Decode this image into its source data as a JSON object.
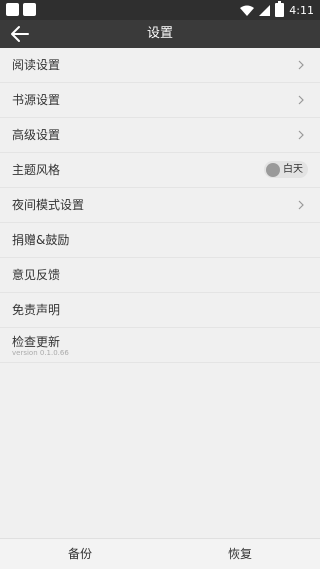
{
  "status_bar": {
    "time": "4:11",
    "battery_level": "",
    "icons": [
      "notification-square-icon",
      "notification-square-icon",
      "wifi-icon",
      "signal-icon",
      "battery-icon"
    ]
  },
  "appbar": {
    "title": "设置",
    "back_icon": "arrow-left-icon"
  },
  "settings": {
    "items": [
      {
        "label": "阅读设置",
        "type": "link"
      },
      {
        "label": "书源设置",
        "type": "link"
      },
      {
        "label": "高级设置",
        "type": "link"
      },
      {
        "label": "主题风格",
        "type": "toggle",
        "toggle_text": "白天"
      },
      {
        "label": "夜间模式设置",
        "type": "link"
      },
      {
        "label": "捐赠&鼓励",
        "type": "plain"
      },
      {
        "label": "意见反馈",
        "type": "plain"
      },
      {
        "label": "免责声明",
        "type": "plain"
      },
      {
        "label": "检查更新",
        "type": "plain",
        "subtitle": "version 0.1.0.66"
      }
    ]
  },
  "bottom_bar": {
    "backup_label": "备份",
    "restore_label": "恢复"
  },
  "colors": {
    "statusbar_bg": "#2f2f2f",
    "appbar_bg": "#3a3a3a",
    "page_bg": "#f0f0f0"
  }
}
